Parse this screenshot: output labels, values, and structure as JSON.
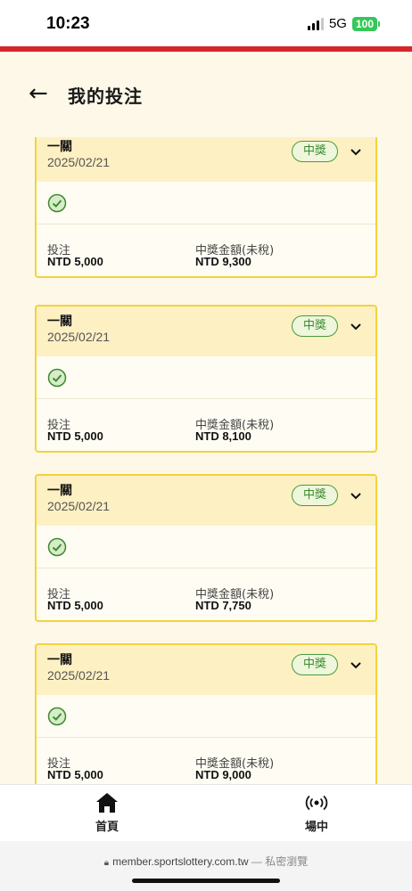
{
  "status_bar": {
    "time": "10:23",
    "network": "5G",
    "battery": "100"
  },
  "header": {
    "back_icon": "arrow-left-icon",
    "title": "我的投注"
  },
  "labels": {
    "bet": "投注",
    "prize": "中獎金額(未稅)"
  },
  "bets": [
    {
      "type": "一關",
      "date": "2025/02/21",
      "status": "中獎",
      "bet_amount": "NTD 5,000",
      "prize_amount": "NTD 9,300"
    },
    {
      "type": "一關",
      "date": "2025/02/21",
      "status": "中獎",
      "bet_amount": "NTD 5,000",
      "prize_amount": "NTD 8,100"
    },
    {
      "type": "一關",
      "date": "2025/02/21",
      "status": "中獎",
      "bet_amount": "NTD 5,000",
      "prize_amount": "NTD 7,750"
    },
    {
      "type": "一關",
      "date": "2025/02/21",
      "status": "中獎",
      "bet_amount": "NTD 5,000",
      "prize_amount": "NTD 9,000"
    }
  ],
  "bottom_nav": {
    "home_label": "首頁",
    "live_label": "場中"
  },
  "browser": {
    "url": "member.sportslottery.com.tw",
    "suffix": "— 私密瀏覽"
  },
  "colors": {
    "accent_red": "#d7262a",
    "card_border": "#f2d33b",
    "win_green": "#4a9a3c"
  }
}
